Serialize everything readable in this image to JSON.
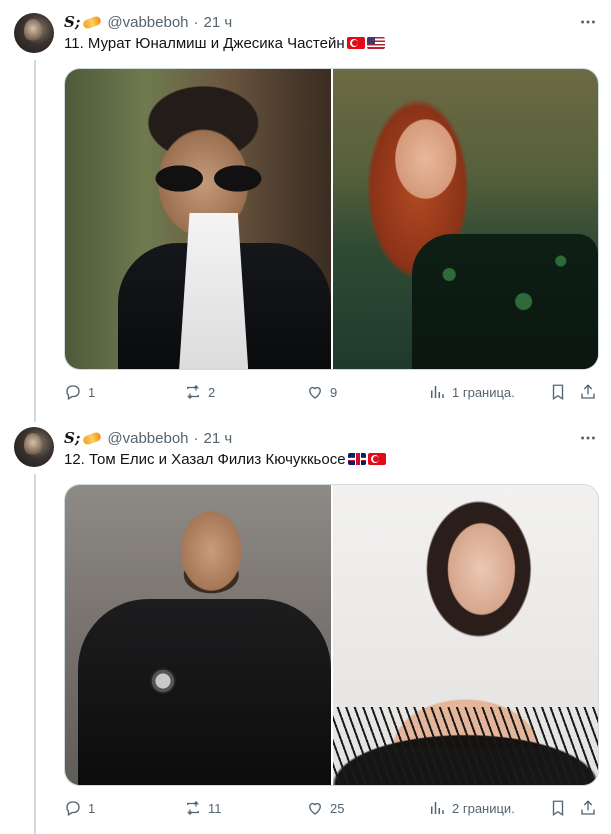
{
  "tweets": [
    {
      "author_name": "S;",
      "handle": "@vabbeboh",
      "time": "21 ч",
      "text": "11. Мурат Юналмиш и Джесика Частейн",
      "replies": "1",
      "retweets": "2",
      "likes": "9",
      "views": "1 граница."
    },
    {
      "author_name": "S;",
      "handle": "@vabbeboh",
      "time": "21 ч",
      "text": "12. Том Елис и Хазал Филиз Кючуккьосе",
      "replies": "1",
      "retweets": "11",
      "likes": "25",
      "views": "2 граници."
    }
  ],
  "colors": {
    "text": "#0f1419",
    "secondary": "#536471",
    "border": "#cfd9de"
  },
  "icons": [
    "more-icon",
    "reply-icon",
    "retweet-icon",
    "like-icon",
    "views-icon",
    "bookmark-icon",
    "share-icon"
  ]
}
